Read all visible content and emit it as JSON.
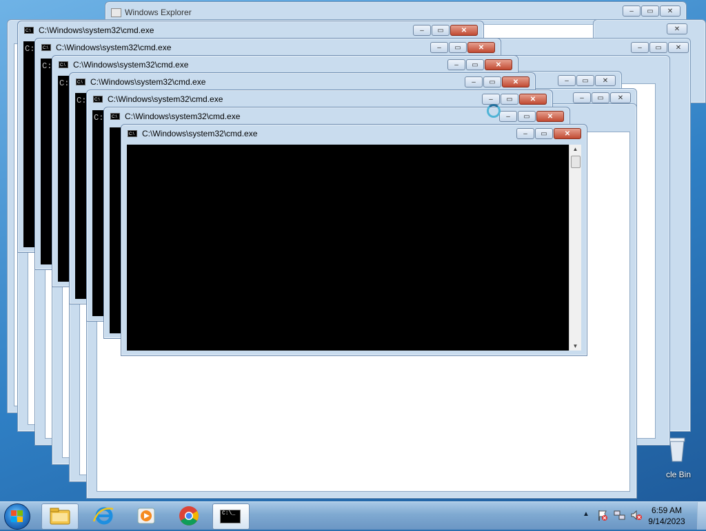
{
  "explorer": {
    "title": "Windows Explorer",
    "search_icon": "magnifier-icon",
    "minimize_icon": "minimize-icon",
    "maximize_icon": "maximize-icon",
    "close_icon": "close-icon"
  },
  "cmd_windows": [
    {
      "title": "C:\\Windows\\system32\\cmd.exe",
      "prompt": "C:"
    },
    {
      "title": "C:\\Windows\\system32\\cmd.exe",
      "prompt": "C:"
    },
    {
      "title": "C:\\Windows\\system32\\cmd.exe",
      "prompt": "C:"
    },
    {
      "title": "C:\\Windows\\system32\\cmd.exe",
      "prompt": "C:"
    },
    {
      "title": "C:\\Windows\\system32\\cmd.exe",
      "prompt": "C:"
    },
    {
      "title": "C:\\Windows\\system32\\cmd.exe",
      "prompt": ""
    },
    {
      "title": "C:\\Windows\\system32\\cmd.exe",
      "prompt": ""
    }
  ],
  "desktop": {
    "recycle_bin_label": "cle Bin"
  },
  "taskbar": {
    "start_icon": "windows-start-icon",
    "pinned": [
      "folder-explorer-icon",
      "internet-explorer-icon",
      "media-player-icon",
      "chrome-icon",
      "cmd-icon"
    ],
    "cmd_icon_text": "C:\\_",
    "tray_icons": [
      "show-hidden-icons-chevron-icon",
      "action-center-flag-icon",
      "network-icon",
      "volume-muted-icon"
    ],
    "time": "6:59 AM",
    "date": "9/14/2023"
  },
  "colors": {
    "chrome": "#c9dcee",
    "console_bg": "#000000",
    "close_button": "#c14a32",
    "taskbar": "#7fa9d1"
  }
}
